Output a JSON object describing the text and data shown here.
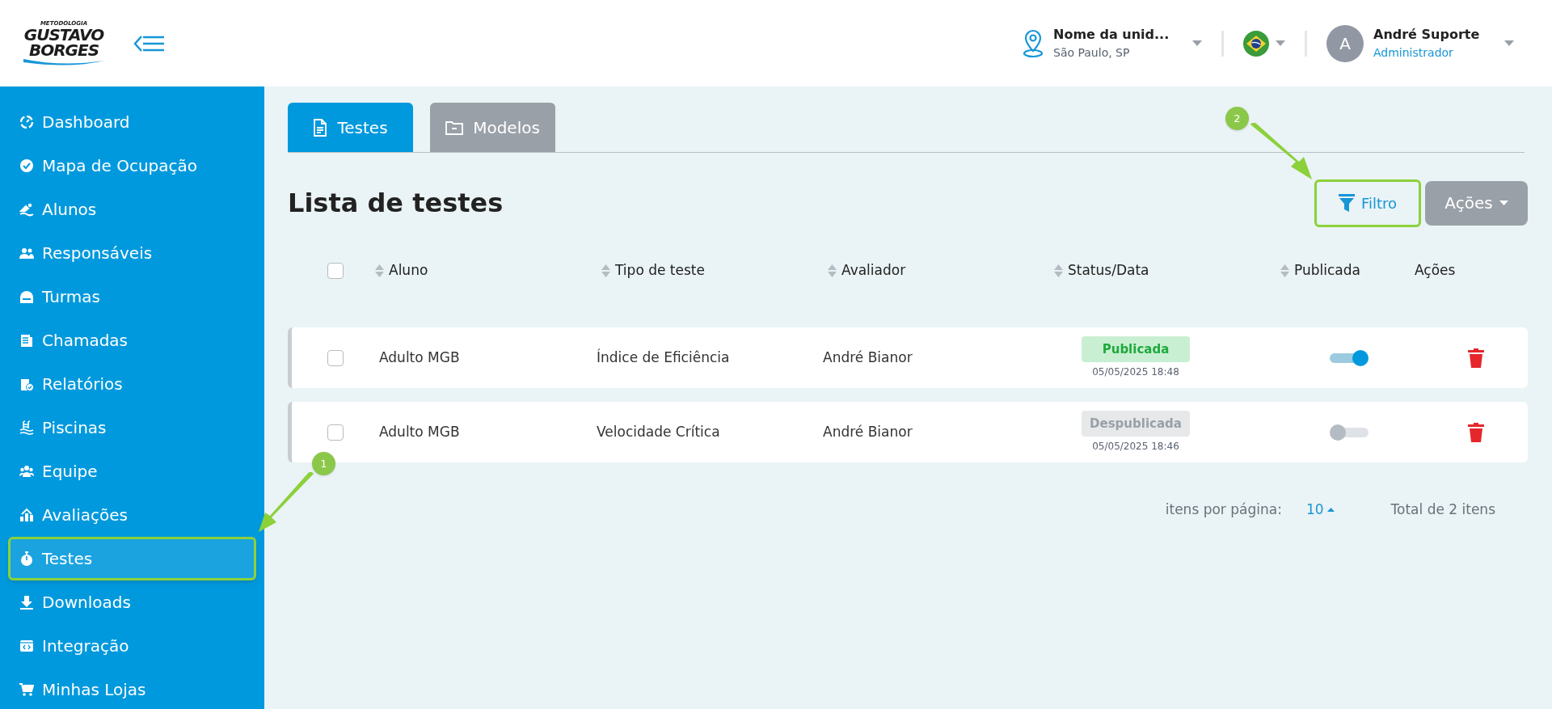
{
  "logo": {
    "tagline": "METODOLOGIA",
    "line_1": "GUSTAVO",
    "line_2": "BORGES"
  },
  "header": {
    "unit": {
      "name": "Nome da unid...",
      "location": "São Paulo, SP"
    },
    "user": {
      "initial": "A",
      "name": "André Suporte",
      "role": "Administrador"
    }
  },
  "sidebar": {
    "items": [
      {
        "label": "Dashboard",
        "selected": false
      },
      {
        "label": "Mapa de Ocupação",
        "selected": false
      },
      {
        "label": "Alunos",
        "selected": false
      },
      {
        "label": "Responsáveis",
        "selected": false
      },
      {
        "label": "Turmas",
        "selected": false
      },
      {
        "label": "Chamadas",
        "selected": false
      },
      {
        "label": "Relatórios",
        "selected": false
      },
      {
        "label": "Piscinas",
        "selected": false
      },
      {
        "label": "Equipe",
        "selected": false
      },
      {
        "label": "Avaliações",
        "selected": false
      },
      {
        "label": "Testes",
        "selected": true
      },
      {
        "label": "Downloads",
        "selected": false
      },
      {
        "label": "Integração",
        "selected": false
      },
      {
        "label": "Minhas Lojas",
        "selected": false
      }
    ]
  },
  "tabs": [
    {
      "label": "Testes",
      "selected": true
    },
    {
      "label": "Modelos",
      "selected": false
    }
  ],
  "title": "Lista de testes",
  "buttons": {
    "filter": "Filtro",
    "actions": "Ações"
  },
  "table": {
    "select_all": {
      "checked": false
    },
    "columns": [
      {
        "label": "Aluno",
        "sortable": true
      },
      {
        "label": "Tipo de teste",
        "sortable": true
      },
      {
        "label": "Avaliador",
        "sortable": true
      },
      {
        "label": "Status/Data",
        "sortable": true
      },
      {
        "label": "Publicada",
        "sortable": true
      },
      {
        "label": "Ações",
        "sortable": false
      }
    ],
    "rows": [
      {
        "checked": false,
        "aluno": "Adulto MGB",
        "tipo": "Índice de Eficiência",
        "avaliador": "André Bianor",
        "status": "Publicada",
        "kind": "published",
        "date": "05/05/2025 18:48",
        "on": true
      },
      {
        "checked": false,
        "aluno": "Adulto MGB",
        "tipo": "Velocidade Crítica",
        "avaliador": "André Bianor",
        "status": "Despublicada",
        "kind": "unpublished",
        "date": "05/05/2025 18:46",
        "on": false
      }
    ]
  },
  "pagination": {
    "label": "itens por página:",
    "per_page": "10",
    "total": "Total de 2 itens"
  },
  "annotations": [
    {
      "label": "1"
    },
    {
      "label": "2"
    }
  ]
}
